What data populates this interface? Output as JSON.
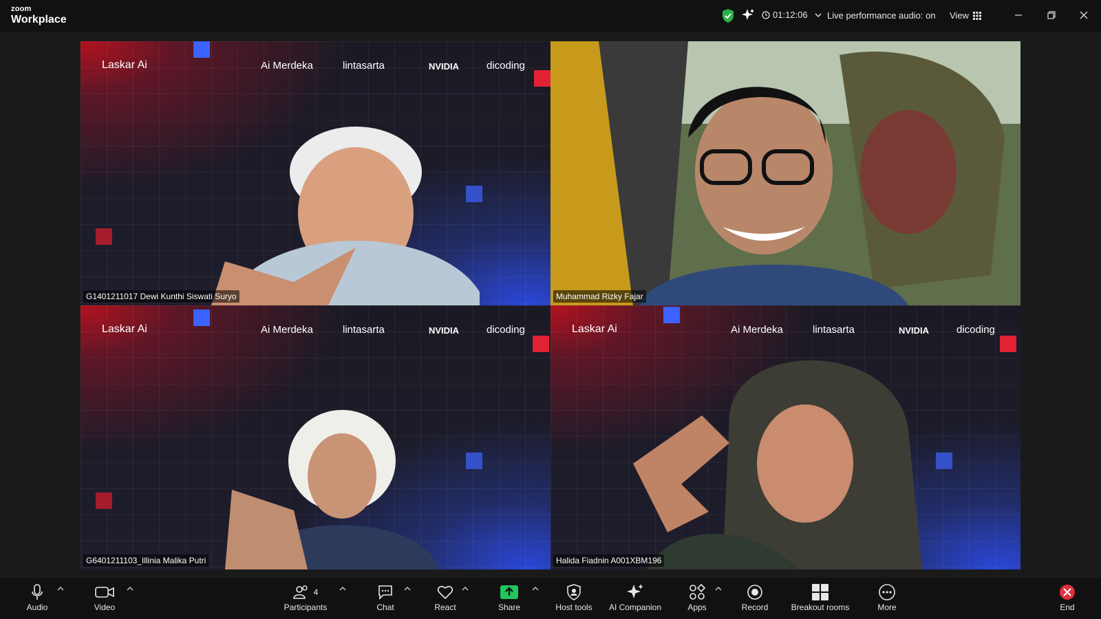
{
  "app": {
    "brand_small": "zoom",
    "brand_big": "Workplace"
  },
  "titlebar": {
    "timer": "01:12:06",
    "live_audio": "Live performance audio: on",
    "view_label": "View"
  },
  "background": {
    "laskar": "Laskar Ai",
    "logo1": "Ai Merdeka",
    "logo2": "lintasarta",
    "logo3": "NVIDIA",
    "logo4": "dicoding"
  },
  "participants": [
    {
      "name": "G1401211017 Dewi Kunthi Siswati Suryo"
    },
    {
      "name": "Muhammad Rizky Fajar"
    },
    {
      "name": "G6401211103_Illinia Malika Putri"
    },
    {
      "name": "Halida Fiadnin A001XBM196"
    }
  ],
  "toolbar": {
    "audio": "Audio",
    "video": "Video",
    "participants": "Participants",
    "participant_count": "4",
    "chat": "Chat",
    "react": "React",
    "share": "Share",
    "host_tools": "Host tools",
    "ai_companion": "AI Companion",
    "apps": "Apps",
    "record": "Record",
    "breakout": "Breakout rooms",
    "more": "More",
    "end": "End"
  },
  "colors": {
    "active_speaker": "#22c55e",
    "share_green": "#22c55e",
    "end_red": "#e02f3b"
  }
}
